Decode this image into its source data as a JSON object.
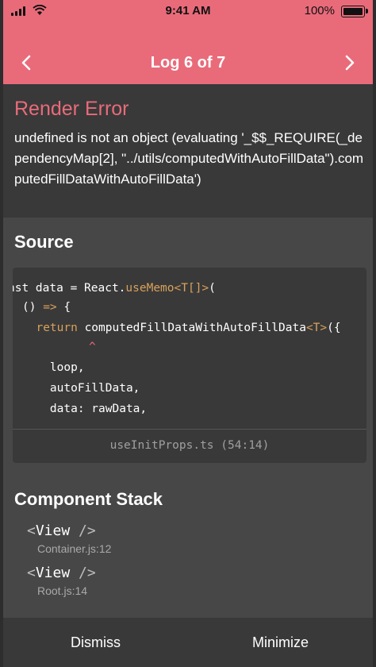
{
  "status_bar": {
    "time": "9:41 AM",
    "battery": "100%",
    "signal_icon": "cellular-signal-icon",
    "wifi_icon": "wifi-icon",
    "battery_icon": "battery-full-icon"
  },
  "header": {
    "title": "Log 6 of 7",
    "prev_icon": "chevron-left-icon",
    "next_icon": "chevron-right-icon",
    "background": "#e96b7a"
  },
  "error": {
    "title": "Render Error",
    "message": "undefined is not an object (evaluating '_$$_REQUIRE(_dependencyMap[2], \"../utils/computedWithAutoFillData\").computedFillDataWithAutoFillData')"
  },
  "source": {
    "title": "Source",
    "code": {
      "l1a": "nst data = React.",
      "l1b": "useMemo",
      "l1c": "<T[]>",
      "l1d": "(",
      "l2a": "() ",
      "l2b": "=>",
      "l2c": " {",
      "l3a": "  return ",
      "l3b": "computedFillDataWithAutoFillData",
      "l3c": "<T>",
      "l3d": "({",
      "l4": "^",
      "l5": "    loop,",
      "l6": "    autoFillData,",
      "l7": "    data: rawData,"
    },
    "file": "useInitProps.ts (54:14)"
  },
  "component_stack": {
    "title": "Component Stack",
    "frames": [
      {
        "name": "View",
        "location": "Container.js:12"
      },
      {
        "name": "View",
        "location": "Root.js:14"
      }
    ]
  },
  "footer": {
    "dismiss": "Dismiss",
    "minimize": "Minimize"
  }
}
